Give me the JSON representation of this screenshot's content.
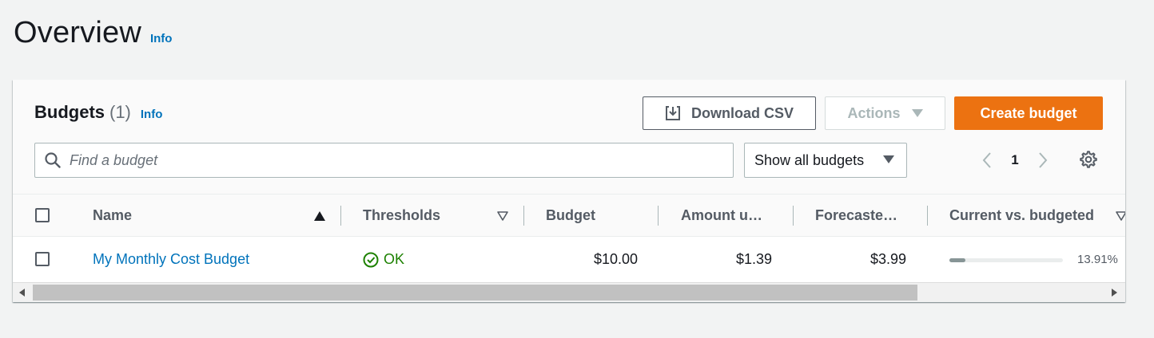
{
  "page": {
    "title": "Overview",
    "info": "Info"
  },
  "budgets": {
    "title": "Budgets",
    "count": "(1)",
    "info": "Info",
    "download_label": "Download CSV",
    "actions_label": "Actions",
    "create_label": "Create budget",
    "search_placeholder": "Find a budget",
    "filter_value": "Show all budgets",
    "page_number": "1"
  },
  "table": {
    "headers": {
      "name": "Name",
      "thresholds": "Thresholds",
      "budget": "Budget",
      "amount_used": "Amount u…",
      "forecasted": "Forecaste…",
      "current_vs_budgeted": "Current vs. budgeted"
    },
    "rows": [
      {
        "name": "My Monthly Cost Budget",
        "threshold_status": "OK",
        "budget": "$10.00",
        "amount_used": "$1.39",
        "forecasted": "$3.99",
        "current_vs_budgeted": "13.91%",
        "progress_fraction": 0.1391
      }
    ]
  },
  "colors": {
    "accent": "#ec7211",
    "link": "#0073bb",
    "ok": "#1d8102"
  }
}
